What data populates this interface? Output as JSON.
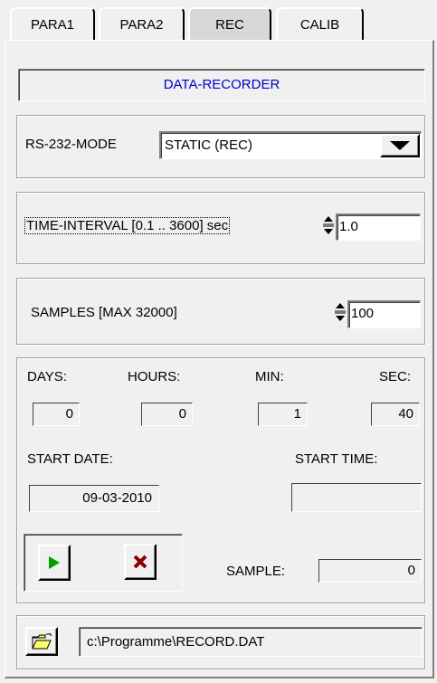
{
  "tabs": [
    {
      "label": "PARA1",
      "active": false
    },
    {
      "label": "PARA2",
      "active": false
    },
    {
      "label": "REC",
      "active": true
    },
    {
      "label": "CALIB",
      "active": false
    }
  ],
  "header": {
    "title": "DATA-RECORDER",
    "title_color": "#0000cc"
  },
  "rs232": {
    "label": "RS-232-MODE",
    "value": "STATIC (REC)"
  },
  "interval": {
    "label": "TIME-INTERVAL [0.1 .. 3600] sec",
    "value": "1.0"
  },
  "samples": {
    "label": "SAMPLES  [MAX 32000]",
    "value": "100"
  },
  "timer": {
    "days_label": "DAYS:",
    "days": "0",
    "hours_label": "HOURS:",
    "hours": "0",
    "min_label": "MIN:",
    "min": "1",
    "sec_label": "SEC:",
    "sec": "40"
  },
  "start": {
    "date_label": "START DATE:",
    "date": "09-03-2010",
    "time_label": "START TIME:",
    "time": ""
  },
  "controls": {
    "play_icon": "play-icon",
    "play_color": "#00a000",
    "stop_icon": "close-icon",
    "stop_color": "#8b0000"
  },
  "sample": {
    "label": "SAMPLE:",
    "value": "0"
  },
  "file": {
    "icon": "open-folder-icon",
    "path": "c:\\Programme\\RECORD.DAT"
  }
}
